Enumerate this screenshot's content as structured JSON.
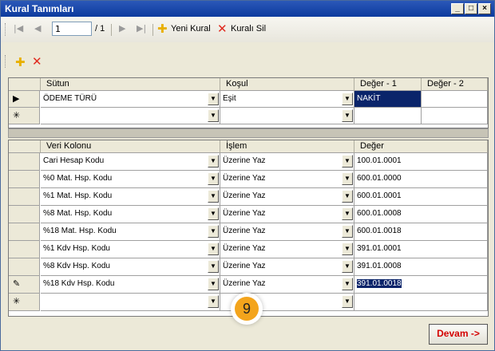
{
  "window": {
    "title": "Kural Tanımları",
    "min": "_",
    "max": "□",
    "close": "×"
  },
  "toolbar": {
    "nav_first": "|◀",
    "nav_prev": "◀",
    "position": "1",
    "of_count": "/ 1",
    "nav_next": "▶",
    "nav_last": "▶|",
    "new_rule": "Yeni Kural",
    "delete_rule": "Kuralı Sil"
  },
  "conditions": {
    "columns": [
      "Sütun",
      "Koşul",
      "Değer - 1",
      "Değer - 2"
    ],
    "rows": [
      {
        "marker": "▶",
        "sutun": "ÖDEME TÜRÜ",
        "kosul": "Eşit",
        "deger1": "NAKİT",
        "deger2": ""
      },
      {
        "marker": "✳",
        "sutun": "",
        "kosul": "",
        "deger1": "",
        "deger2": ""
      }
    ]
  },
  "mappings": {
    "columns": [
      "Veri Kolonu",
      "İşlem",
      "Değer"
    ],
    "rows": [
      {
        "marker": "",
        "veri": "Cari Hesap Kodu",
        "islem": "Üzerine Yaz",
        "deger": "100.01.0001"
      },
      {
        "marker": "",
        "veri": "%0 Mat. Hsp. Kodu",
        "islem": "Üzerine Yaz",
        "deger": "600.01.0000"
      },
      {
        "marker": "",
        "veri": "%1 Mat. Hsp. Kodu",
        "islem": "Üzerine Yaz",
        "deger": "600.01.0001"
      },
      {
        "marker": "",
        "veri": "%8 Mat. Hsp. Kodu",
        "islem": "Üzerine Yaz",
        "deger": "600.01.0008"
      },
      {
        "marker": "",
        "veri": "%18 Mat. Hsp. Kodu",
        "islem": "Üzerine Yaz",
        "deger": "600.01.0018"
      },
      {
        "marker": "",
        "veri": "%1 Kdv Hsp. Kodu",
        "islem": "Üzerine Yaz",
        "deger": "391.01.0001"
      },
      {
        "marker": "",
        "veri": "%8 Kdv Hsp. Kodu",
        "islem": "Üzerine Yaz",
        "deger": "391.01.0008"
      },
      {
        "marker": "✎",
        "veri": "%18 Kdv Hsp. Kodu",
        "islem": "Üzerine Yaz",
        "deger": "391.01.0018"
      },
      {
        "marker": "✳",
        "veri": "",
        "islem": "",
        "deger": ""
      }
    ]
  },
  "step_badge": "9",
  "continue_button": "Devam ->",
  "colors": {
    "accent": "#0a246a",
    "badge": "#f3a41c",
    "danger": "#d40000"
  }
}
